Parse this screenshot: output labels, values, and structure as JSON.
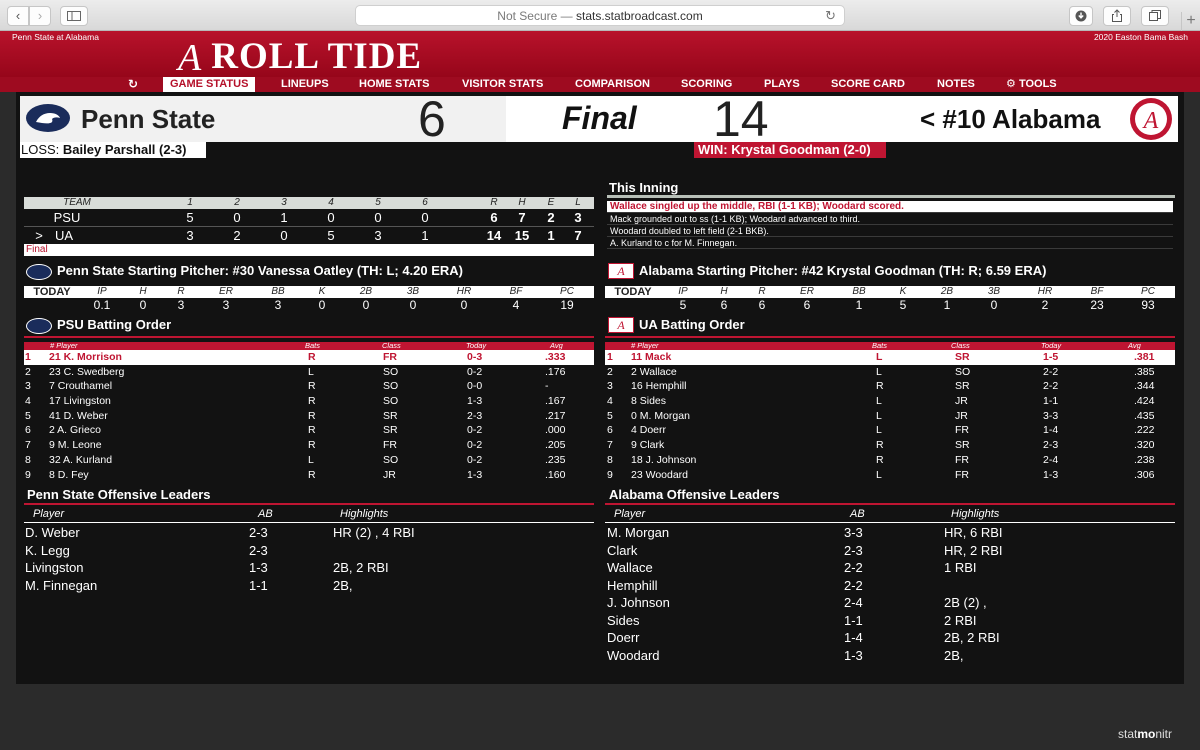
{
  "browser": {
    "url_prefix": "Not Secure — ",
    "url": "stats.statbroadcast.com"
  },
  "header": {
    "left_text": "Penn State at Alabama",
    "right_text": "2020 Easton Bama Bash",
    "logo_letter": "A",
    "logo_text": "ROLL TIDE"
  },
  "nav": {
    "items": [
      "GAME STATUS",
      "LINEUPS",
      "HOME STATS",
      "VISITOR STATS",
      "COMPARISON",
      "SCORING",
      "PLAYS",
      "SCORE CARD",
      "NOTES",
      "TOOLS"
    ]
  },
  "scoreboard": {
    "visitor_name": "Penn State",
    "visitor_score": "6",
    "status": "Final",
    "home_score": "14",
    "home_name": "< #10 Alabama",
    "loss_label": "LOSS:",
    "loss_pitcher": "Bailey Parshall (2-3)",
    "win_label": "WIN:",
    "win_pitcher": "Krystal Goodman (2-0)"
  },
  "linescore": {
    "headers": [
      "TEAM",
      "1",
      "2",
      "3",
      "4",
      "5",
      "6",
      "R",
      "H",
      "E",
      "L"
    ],
    "rows": [
      {
        "marker": "",
        "team": "PSU",
        "innings": [
          "5",
          "0",
          "1",
          "0",
          "0",
          "0"
        ],
        "r": "6",
        "h": "7",
        "e": "2",
        "l": "3"
      },
      {
        "marker": ">",
        "team": "UA",
        "innings": [
          "3",
          "2",
          "0",
          "5",
          "3",
          "1"
        ],
        "r": "14",
        "h": "15",
        "e": "1",
        "l": "7"
      }
    ],
    "final_label": "Final"
  },
  "this_inning": {
    "title": "This Inning",
    "plays": [
      "Wallace singled up the middle, RBI (1-1 KB); Woodard scored.",
      "Mack grounded out to ss (1-1 KB); Woodard advanced to third.",
      "Woodard doubled to left field (2-1 BKB).",
      "A. Kurland to c for M. Finnegan."
    ]
  },
  "pitching": {
    "headers": [
      "TODAY",
      "IP",
      "H",
      "R",
      "ER",
      "BB",
      "K",
      "2B",
      "3B",
      "HR",
      "BF",
      "PC"
    ],
    "visitor": {
      "title": "Penn State Starting Pitcher: #30 Vanessa Oatley (TH: L; 4.20 ERA)",
      "values": [
        "0.1",
        "0",
        "3",
        "3",
        "3",
        "0",
        "0",
        "0",
        "0",
        "4",
        "19"
      ]
    },
    "home": {
      "title": "Alabama Starting Pitcher: #42 Krystal Goodman (TH: R; 6.59 ERA)",
      "values": [
        "5",
        "6",
        "6",
        "6",
        "1",
        "5",
        "1",
        "0",
        "2",
        "23",
        "93"
      ]
    }
  },
  "batting": {
    "headers": [
      "# Player",
      "Bats",
      "Class",
      "Today",
      "Avg"
    ],
    "visitor": {
      "title": "PSU Batting Order",
      "rows": [
        {
          "n": "1",
          "player": "21 K. Morrison",
          "bats": "R",
          "cls": "FR",
          "today": "0-3",
          "avg": ".333"
        },
        {
          "n": "2",
          "player": "23 C. Swedberg",
          "bats": "L",
          "cls": "SO",
          "today": "0-2",
          "avg": ".176"
        },
        {
          "n": "3",
          "player": "7 Crouthamel",
          "bats": "R",
          "cls": "SO",
          "today": "0-0",
          "avg": "-"
        },
        {
          "n": "4",
          "player": "17 Livingston",
          "bats": "R",
          "cls": "SO",
          "today": "1-3",
          "avg": ".167"
        },
        {
          "n": "5",
          "player": "41 D. Weber",
          "bats": "R",
          "cls": "SR",
          "today": "2-3",
          "avg": ".217"
        },
        {
          "n": "6",
          "player": "2 A. Grieco",
          "bats": "R",
          "cls": "SR",
          "today": "0-2",
          "avg": ".000"
        },
        {
          "n": "7",
          "player": "9 M. Leone",
          "bats": "R",
          "cls": "FR",
          "today": "0-2",
          "avg": ".205"
        },
        {
          "n": "8",
          "player": "32 A. Kurland",
          "bats": "L",
          "cls": "SO",
          "today": "0-2",
          "avg": ".235"
        },
        {
          "n": "9",
          "player": "8 D. Fey",
          "bats": "R",
          "cls": "JR",
          "today": "1-3",
          "avg": ".160"
        }
      ]
    },
    "home": {
      "title": "UA Batting Order",
      "rows": [
        {
          "n": "1",
          "player": "11 Mack",
          "bats": "L",
          "cls": "SR",
          "today": "1-5",
          "avg": ".381"
        },
        {
          "n": "2",
          "player": "2 Wallace",
          "bats": "L",
          "cls": "SO",
          "today": "2-2",
          "avg": ".385"
        },
        {
          "n": "3",
          "player": "16 Hemphill",
          "bats": "R",
          "cls": "SR",
          "today": "2-2",
          "avg": ".344"
        },
        {
          "n": "4",
          "player": "8 Sides",
          "bats": "L",
          "cls": "JR",
          "today": "1-1",
          "avg": ".424"
        },
        {
          "n": "5",
          "player": "0 M. Morgan",
          "bats": "L",
          "cls": "JR",
          "today": "3-3",
          "avg": ".435"
        },
        {
          "n": "6",
          "player": "4 Doerr",
          "bats": "L",
          "cls": "FR",
          "today": "1-4",
          "avg": ".222"
        },
        {
          "n": "7",
          "player": "9 Clark",
          "bats": "R",
          "cls": "SR",
          "today": "2-3",
          "avg": ".320"
        },
        {
          "n": "8",
          "player": "18 J. Johnson",
          "bats": "R",
          "cls": "FR",
          "today": "2-4",
          "avg": ".238"
        },
        {
          "n": "9",
          "player": "23 Woodard",
          "bats": "L",
          "cls": "FR",
          "today": "1-3",
          "avg": ".306"
        }
      ]
    }
  },
  "leaders": {
    "headers": [
      "Player",
      "AB",
      "Highlights"
    ],
    "visitor": {
      "title": "Penn State Offensive Leaders",
      "rows": [
        {
          "player": "D. Weber",
          "ab": "2-3",
          "hl": "HR (2) , 4 RBI"
        },
        {
          "player": "K. Legg",
          "ab": "2-3",
          "hl": ""
        },
        {
          "player": "Livingston",
          "ab": "1-3",
          "hl": "2B, 2 RBI"
        },
        {
          "player": "M. Finnegan",
          "ab": "1-1",
          "hl": "2B,"
        }
      ]
    },
    "home": {
      "title": "Alabama Offensive Leaders",
      "rows": [
        {
          "player": "M. Morgan",
          "ab": "3-3",
          "hl": "HR, 6 RBI"
        },
        {
          "player": "Clark",
          "ab": "2-3",
          "hl": "HR, 2 RBI"
        },
        {
          "player": "Wallace",
          "ab": "2-2",
          "hl": "1 RBI"
        },
        {
          "player": "Hemphill",
          "ab": "2-2",
          "hl": ""
        },
        {
          "player": "J. Johnson",
          "ab": "2-4",
          "hl": "2B (2) ,"
        },
        {
          "player": "Sides",
          "ab": "1-1",
          "hl": "2 RBI"
        },
        {
          "player": "Doerr",
          "ab": "1-4",
          "hl": "2B, 2 RBI"
        },
        {
          "player": "Woodard",
          "ab": "1-3",
          "hl": "2B,"
        }
      ]
    }
  },
  "footer": {
    "brand_a": "stat",
    "brand_b": "mo",
    "brand_c": "nitr"
  },
  "colors": {
    "crimson": "#bf1532",
    "navy": "#1a2c5b"
  }
}
